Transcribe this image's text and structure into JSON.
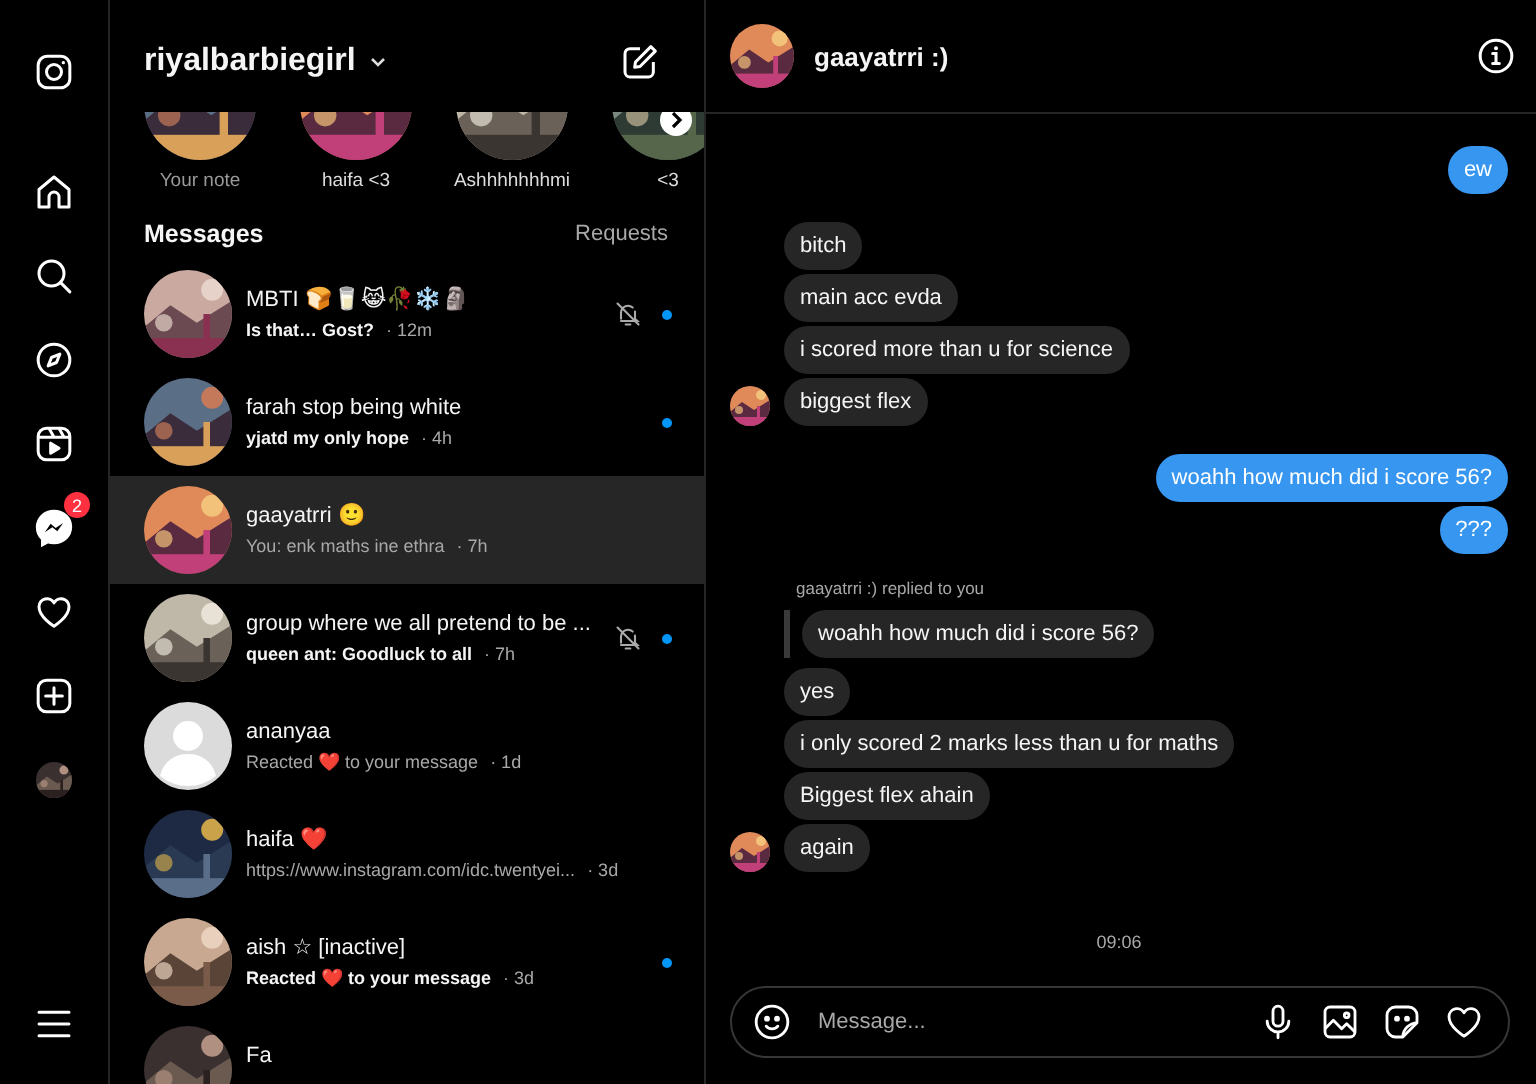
{
  "nav": [
    {
      "kind": "instagram",
      "selected": false
    },
    {
      "kind": "home",
      "selected": false
    },
    {
      "kind": "search",
      "selected": false
    },
    {
      "kind": "explore",
      "selected": false
    },
    {
      "kind": "reels",
      "selected": false
    },
    {
      "kind": "messages",
      "selected": true,
      "badge": "2"
    },
    {
      "kind": "notifications",
      "selected": false
    },
    {
      "kind": "create",
      "selected": false
    },
    {
      "kind": "profile",
      "selected": false
    },
    {
      "kind": "menu",
      "selected": false
    }
  ],
  "inbox": {
    "username": "riyalbarbiegirl",
    "notes": [
      {
        "label": "Your note"
      },
      {
        "label": "haifa <3"
      },
      {
        "label": "Ashhhhhhhmi"
      },
      {
        "label": "<3"
      }
    ],
    "heading": "Messages",
    "requests": "Requests",
    "conversations": [
      {
        "name": "MBTI 🍞🥛😹🥀❄️🗿",
        "preview": "Is that… Gost?",
        "time": "· 12m",
        "unread": true,
        "muted": true,
        "selected": false
      },
      {
        "name": "farah stop being white",
        "preview": "yjatd my only hope",
        "time": "· 4h",
        "unread": true,
        "muted": false,
        "selected": false
      },
      {
        "name": "gaayatrri 🙂",
        "preview": "You: enk maths ine ethra",
        "time": "· 7h",
        "unread": false,
        "muted": false,
        "selected": true
      },
      {
        "name": "group where we all pretend to be ...",
        "preview": "queen ant: Goodluck to all",
        "time": "· 7h",
        "unread": true,
        "muted": true,
        "selected": false
      },
      {
        "name": "ananyaa",
        "preview": "Reacted ❤️ to your message",
        "time": "· 1d",
        "unread": false,
        "muted": false,
        "selected": false,
        "kind": "default"
      },
      {
        "name": "haifa ❤️",
        "preview": "https://www.instagram.com/idc.twentyei...",
        "time": "· 3d",
        "unread": false,
        "muted": false,
        "selected": false
      },
      {
        "name": "aish ☆ [inactive]",
        "preview": "Reacted ❤️ to your message",
        "time": "· 3d",
        "unread": true,
        "muted": false,
        "selected": false
      },
      {
        "name": "Fa",
        "unread": false,
        "muted": false,
        "selected": false
      }
    ]
  },
  "chat": {
    "name": "gaayatrri :)",
    "messages": [
      {
        "kind": "sent",
        "text": "ew"
      },
      {
        "kind": "received",
        "text": "bitch",
        "avatar": false
      },
      {
        "kind": "received",
        "text": "main acc evda",
        "avatar": false
      },
      {
        "kind": "received",
        "text": "i scored more than u for science",
        "avatar": false
      },
      {
        "kind": "received",
        "text": "biggest flex",
        "avatar": true
      },
      {
        "kind": "sent",
        "text": "woahh how much did i score 56?"
      },
      {
        "kind": "sent",
        "text": "???"
      },
      {
        "kind": "reply",
        "label": "gaayatrri :) replied to you",
        "text": "woahh how much did i score 56?"
      },
      {
        "kind": "received",
        "text": "yes",
        "avatar": false
      },
      {
        "kind": "received",
        "text": "i only scored 2 marks less than u for maths",
        "avatar": false
      },
      {
        "kind": "received",
        "text": "Biggest flex ahain",
        "avatar": false
      },
      {
        "kind": "received",
        "text": "again",
        "avatar": true
      },
      {
        "kind": "time",
        "text": "09:06"
      }
    ],
    "composer": {
      "placeholder": "Message..."
    }
  }
}
